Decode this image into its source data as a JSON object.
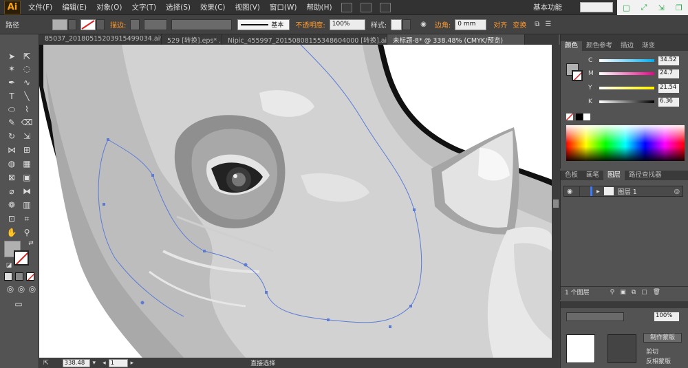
{
  "app": {
    "logo": "Ai",
    "workspace": "基本功能"
  },
  "menu": [
    "文件(F)",
    "编辑(E)",
    "对象(O)",
    "文字(T)",
    "选择(S)",
    "效果(C)",
    "视图(V)",
    "窗口(W)",
    "帮助(H)"
  ],
  "control": {
    "selection_label": "路径",
    "stroke_label": "描边:",
    "stroke_style": "基本",
    "opacity_label": "不透明度:",
    "opacity_value": "100%",
    "style_label": "样式:",
    "corner_label": "边角:",
    "corner_value": "0 mm",
    "align_label": "对齐",
    "transform_label": "变换"
  },
  "tabs": [
    {
      "label": "85037_20180515203915499034.ai*",
      "active": false
    },
    {
      "label": "529 [转换].eps* ...",
      "active": false
    },
    {
      "label": "Nipic_455997_20150808155348604000 [转换].ai*",
      "active": false
    },
    {
      "label": "未标题-8* @ 338.48% (CMYK/预览)",
      "active": true
    }
  ],
  "status": {
    "zoom": "338.48",
    "page": "1",
    "tool_text": "直接选择"
  },
  "color_panel": {
    "tabs": [
      "颜色",
      "颜色参考",
      "描边",
      "渐变"
    ],
    "channels": [
      {
        "name": "C",
        "value": "34.52"
      },
      {
        "name": "M",
        "value": "24.7"
      },
      {
        "name": "Y",
        "value": "21.54"
      },
      {
        "name": "K",
        "value": "6.36"
      }
    ]
  },
  "layers_panel": {
    "tabs": [
      "色板",
      "画笔",
      "图层",
      "路径查找器"
    ],
    "layer_name": "图层 1",
    "layer_count": "1 个图层"
  },
  "bottom_panel": {
    "opacity_value": "100%",
    "mask_button": "制作蒙版",
    "clip_label": "剪切",
    "invert_label": "反相蒙版"
  },
  "colors": {
    "accent": "#ff9a2e",
    "path": "#5b7bd6",
    "layer_mark": "#3c7bff"
  }
}
